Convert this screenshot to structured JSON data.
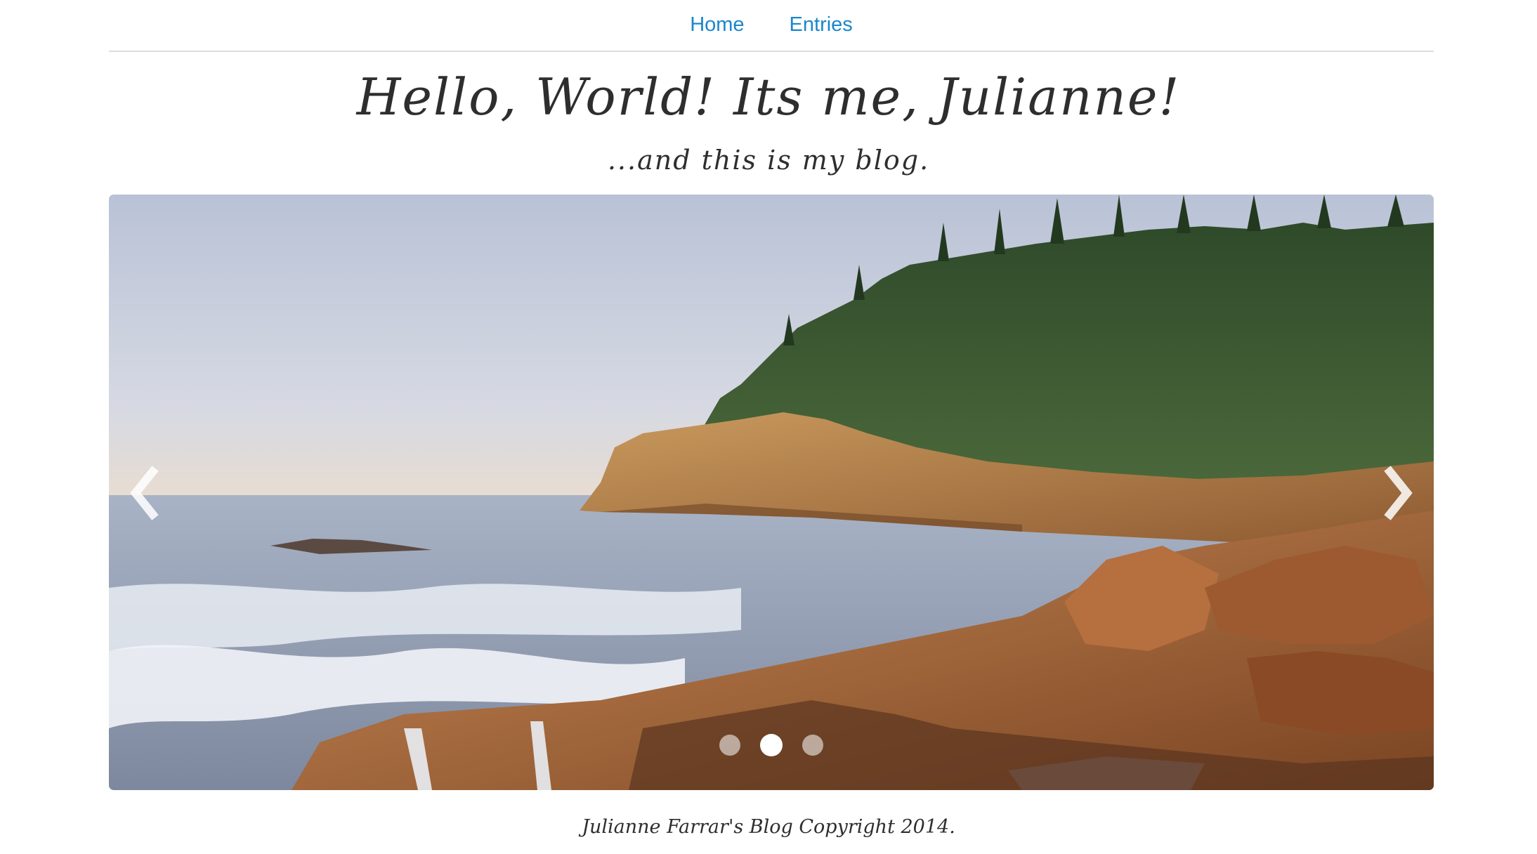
{
  "nav": {
    "items": [
      {
        "label": "Home"
      },
      {
        "label": "Entries"
      }
    ]
  },
  "header": {
    "title": "Hello, World! Its me, Julianne!",
    "subtitle": "...and this is my blog."
  },
  "carousel": {
    "slide_count": 3,
    "active_index": 1,
    "prev_icon": "chevron-left-icon",
    "next_icon": "chevron-right-icon"
  },
  "footer": {
    "text": "Julianne Farrar's Blog Copyright 2014."
  },
  "colors": {
    "link": "#1a87cc",
    "text": "#2e2e2e",
    "divider": "#dddddd"
  }
}
